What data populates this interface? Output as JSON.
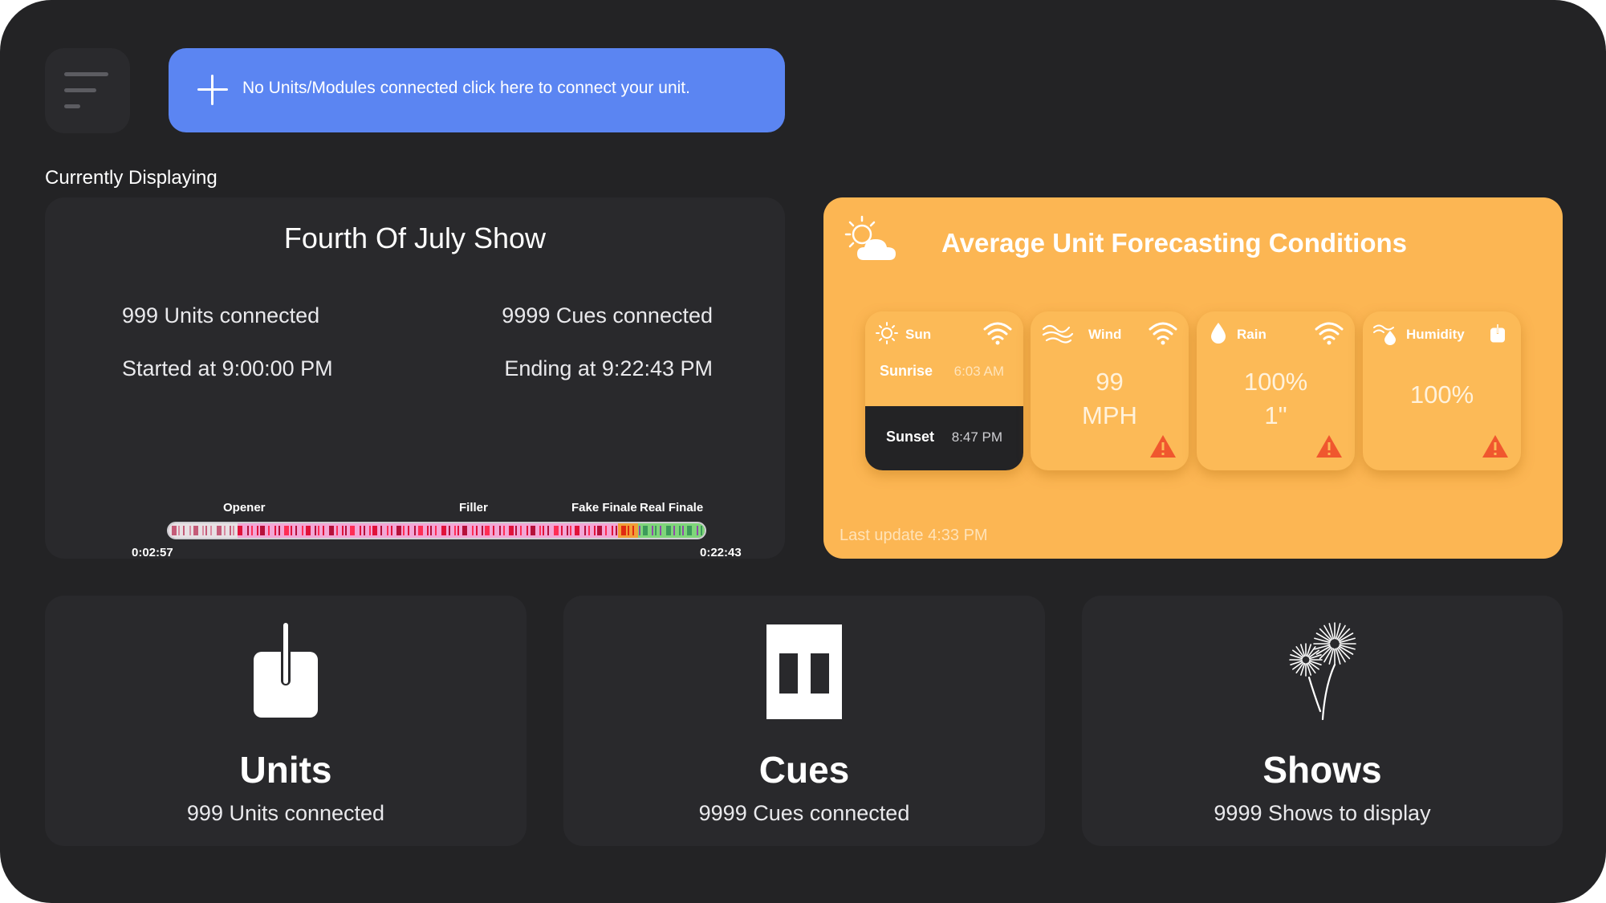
{
  "banner": {
    "text": "No Units/Modules connected click here to connect your unit."
  },
  "section_label": "Currently Displaying",
  "show": {
    "title": "Fourth Of July Show",
    "units_connected": "999 Units connected",
    "cues_connected": "9999 Cues connected",
    "started": "Started at 9:00:00 PM",
    "ending": "Ending at 9:22:43 PM",
    "timeline": {
      "segments": [
        "Opener",
        "Filler",
        "Fake Finale",
        "Real Finale"
      ],
      "start_time": "0:02:57",
      "end_time": "0:22:43"
    }
  },
  "weather": {
    "title": "Average Unit Forecasting Conditions",
    "last_update": "Last update 4:33 PM",
    "sun": {
      "label": "Sun",
      "sunrise_label": "Sunrise",
      "sunrise_time": "6:03 AM",
      "sunset_label": "Sunset",
      "sunset_time": "8:47 PM"
    },
    "wind": {
      "label": "Wind",
      "value": "99",
      "unit": "MPH"
    },
    "rain": {
      "label": "Rain",
      "value": "100%",
      "amount": "1\""
    },
    "humidity": {
      "label": "Humidity",
      "value": "100%"
    }
  },
  "cards": {
    "units": {
      "title": "Units",
      "subtitle": "999 Units connected"
    },
    "cues": {
      "title": "Cues",
      "subtitle": "9999 Cues connected"
    },
    "shows": {
      "title": "Shows",
      "subtitle": "9999 Shows to display"
    }
  },
  "colors": {
    "background": "#232325",
    "card": "#29292c",
    "accent_blue": "#5b85f2",
    "accent_orange": "#fcb653",
    "warning": "#f0572e"
  }
}
